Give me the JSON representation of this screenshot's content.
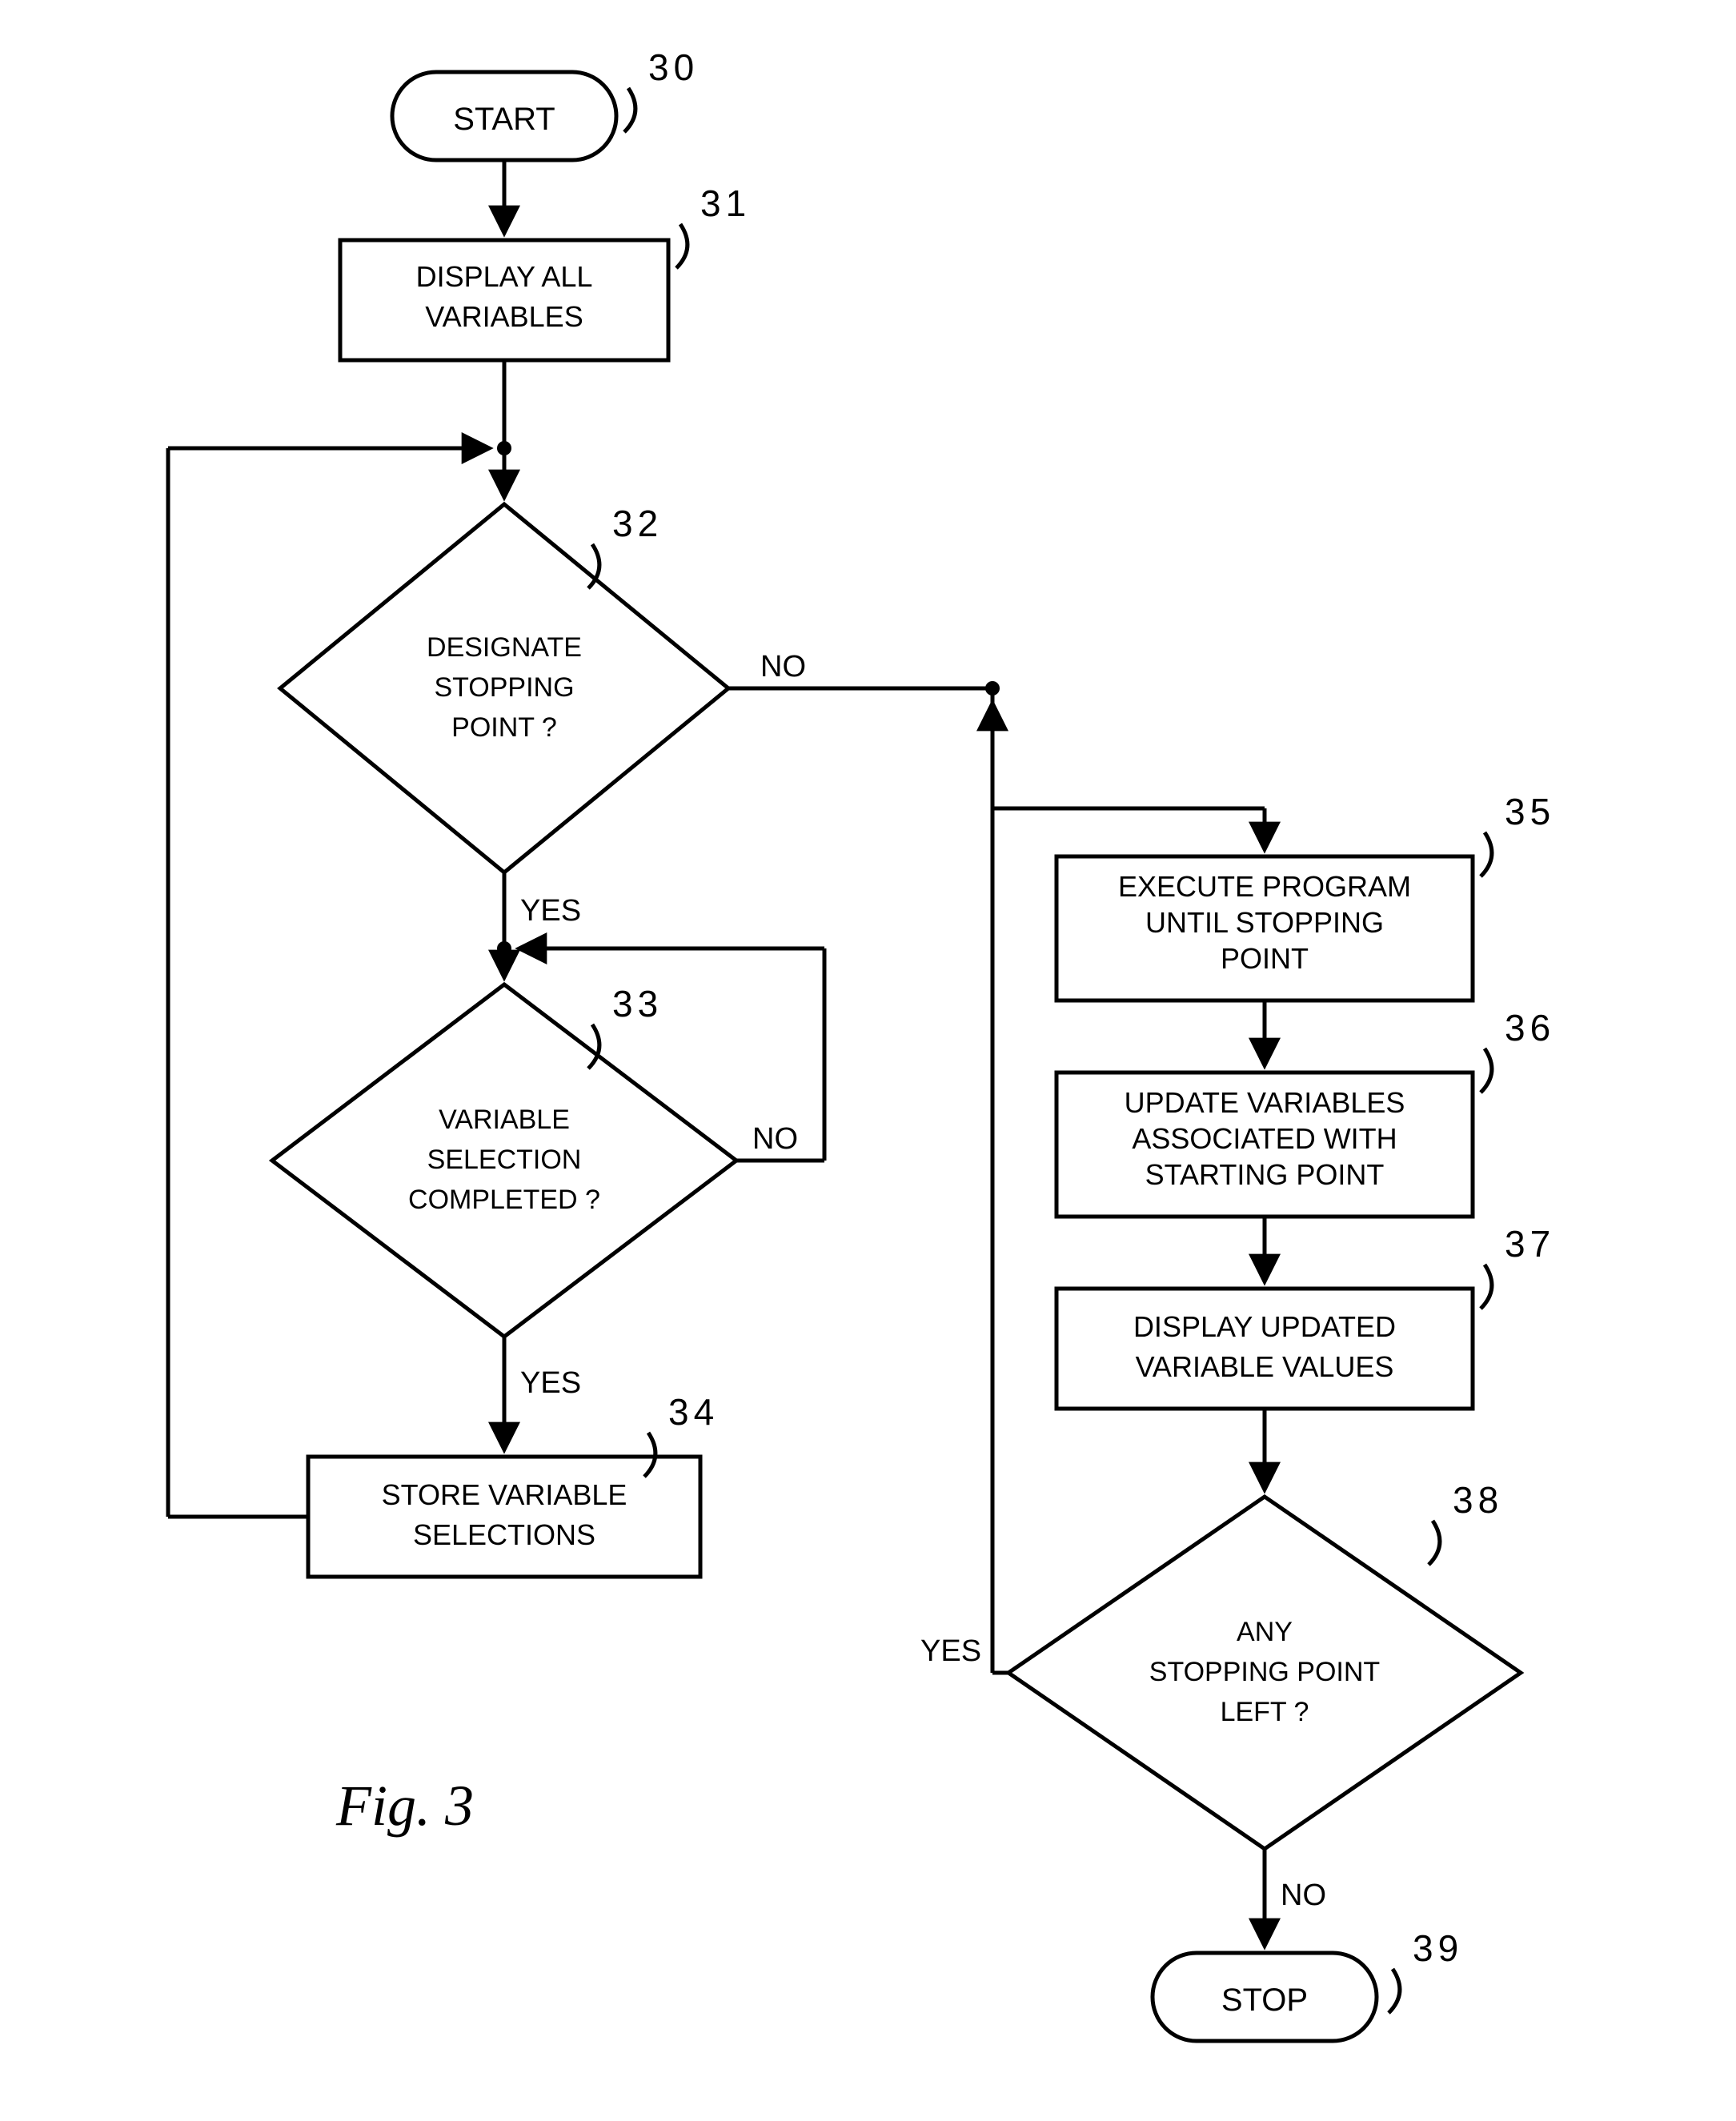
{
  "nodes": {
    "n30": {
      "ref": "30",
      "text": "START"
    },
    "n31": {
      "ref": "31",
      "lines": [
        "DISPLAY ALL",
        "VARIABLES"
      ]
    },
    "n32": {
      "ref": "32",
      "lines": [
        "DESIGNATE",
        "STOPPING",
        "POINT ?"
      ]
    },
    "n33": {
      "ref": "33",
      "lines": [
        "VARIABLE",
        "SELECTION",
        "COMPLETED ?"
      ]
    },
    "n34": {
      "ref": "34",
      "lines": [
        "STORE VARIABLE",
        "SELECTIONS"
      ]
    },
    "n35": {
      "ref": "35",
      "lines": [
        "EXECUTE PROGRAM",
        "UNTIL STOPPING",
        "POINT"
      ]
    },
    "n36": {
      "ref": "36",
      "lines": [
        "UPDATE VARIABLES",
        "ASSOCIATED WITH",
        "STARTING POINT"
      ]
    },
    "n37": {
      "ref": "37",
      "lines": [
        "DISPLAY UPDATED",
        "VARIABLE VALUES"
      ]
    },
    "n38": {
      "ref": "38",
      "lines": [
        "ANY",
        "STOPPING POINT",
        "LEFT ?"
      ]
    },
    "n39": {
      "ref": "39",
      "text": "STOP"
    }
  },
  "edge_labels": {
    "n32_no": "NO",
    "n32_yes": "YES",
    "n33_no": "NO",
    "n33_yes": "YES",
    "n38_yes": "YES",
    "n38_no": "NO"
  },
  "figure_label": "Fig. 3"
}
